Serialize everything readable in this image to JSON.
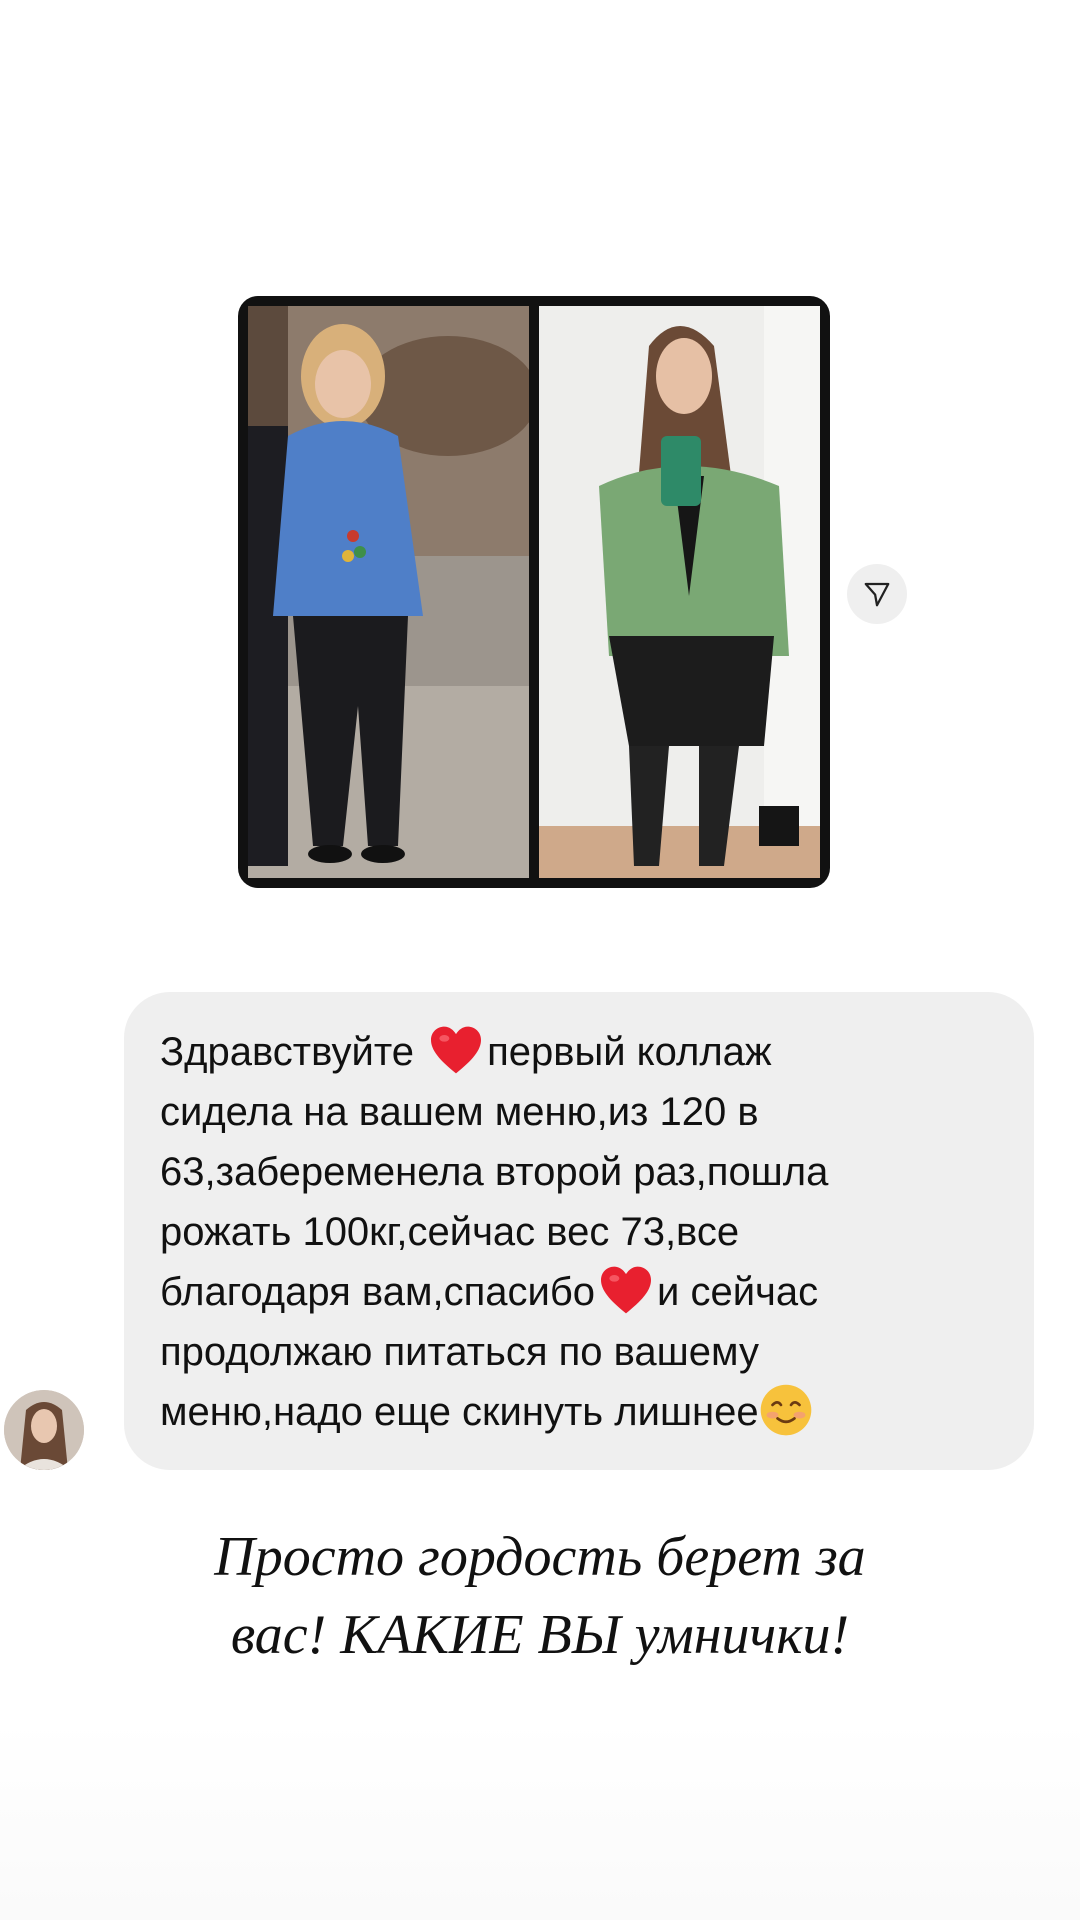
{
  "story": {
    "message": {
      "line_1_before_heart": "Здравствуйте ",
      "line_1_after_heart": "первый коллаж",
      "line_2": "сидела на вашем меню,из 120 в",
      "line_3": "63,забеременела второй раз,пошла",
      "line_4": "рожать 100кг,сейчас вес 73,все",
      "line_5_before_heart": "благодаря вам,спасибо",
      "line_5_after_heart": "и сейчас",
      "line_6": "продолжаю питаться по вашему",
      "line_7": "меню,надо еще скинуть лишнее",
      "emoji_heart": "heart-emoji",
      "emoji_smile": "smiling-face-emoji"
    },
    "caption": {
      "line_1": "Просто гордость берет за",
      "line_2": "вас! КАКИЕ ВЫ умнички!"
    },
    "icons": {
      "share": "paper-plane-icon"
    },
    "colors": {
      "bubble": "#efefef",
      "heart": "#e8202f",
      "background": "#ffffff"
    }
  }
}
